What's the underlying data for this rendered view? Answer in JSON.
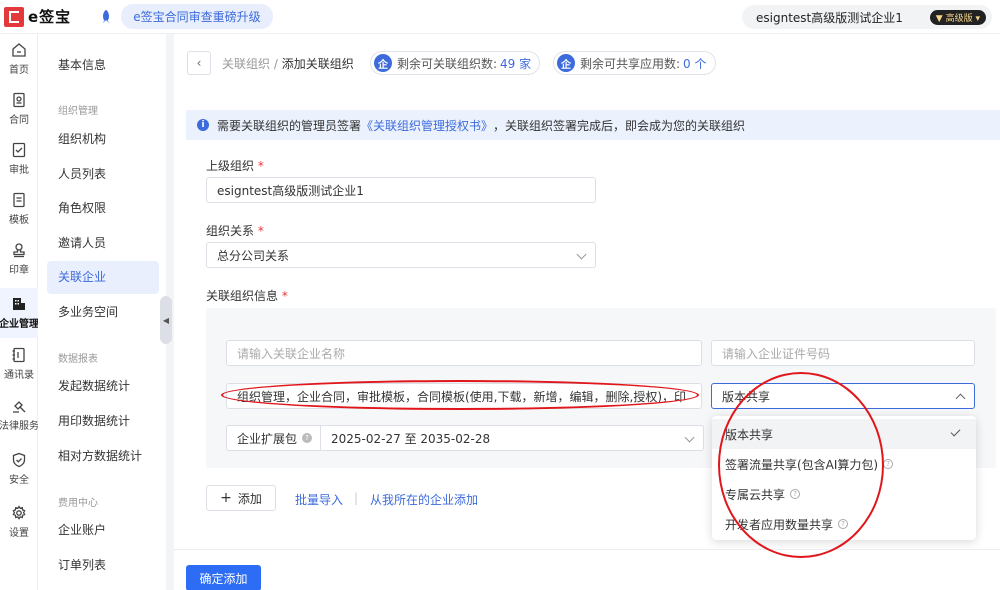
{
  "topbar": {
    "logo_text": "e签宝",
    "promo": "e签宝合同审查重磅升级",
    "company": "esigntest高级版测试企业1",
    "plan_badge": "高级版"
  },
  "rail": [
    {
      "label": "首页",
      "icon": "home-icon"
    },
    {
      "label": "合同",
      "icon": "contract-icon"
    },
    {
      "label": "审批",
      "icon": "approval-icon"
    },
    {
      "label": "模板",
      "icon": "template-icon"
    },
    {
      "label": "印章",
      "icon": "seal-icon"
    },
    {
      "label": "企业管理",
      "icon": "enterprise-icon"
    },
    {
      "label": "通讯录",
      "icon": "contacts-icon"
    },
    {
      "label": "法律服务",
      "icon": "legal-icon"
    },
    {
      "label": "安全",
      "icon": "shield-icon"
    },
    {
      "label": "设置",
      "icon": "gear-icon"
    }
  ],
  "menu": {
    "basic": "基本信息",
    "group_org": "组织管理",
    "org_items": [
      "组织机构",
      "人员列表",
      "角色权限",
      "邀请人员",
      "关联企业",
      "多业务空间"
    ],
    "group_report": "数据报表",
    "report_items": [
      "发起数据统计",
      "用印数据统计",
      "相对方数据统计"
    ],
    "group_fee": "费用中心",
    "fee_items": [
      "企业账户",
      "订单列表"
    ]
  },
  "header": {
    "breadcrumb_parent": "关联组织",
    "breadcrumb_sep": " / ",
    "breadcrumb_current": "添加关联组织",
    "chip1_label": "剩余可关联组织数:",
    "chip1_value": "49 家",
    "chip2_label": "剩余可共享应用数:",
    "chip2_value": "0 个"
  },
  "notice": {
    "prefix": "需要关联组织的管理员签署",
    "link": "《关联组织管理授权书》",
    "suffix": "，关联组织签署完成后，即会成为您的关联组织"
  },
  "form": {
    "parent_label": "上级组织",
    "parent_value": "esigntest高级版测试企业1",
    "relation_label": "组织关系",
    "relation_value": "总分公司关系",
    "info_label": "关联组织信息",
    "required_mark": "*",
    "name_placeholder": "请输入关联企业名称",
    "id_placeholder": "请输入企业证件号码",
    "permissions_value": "组织管理，企业合同，审批模板，合同模板(使用,下载，新增，编辑，删除,授权)，印",
    "share_value": "版本共享",
    "ext_label": "企业扩展包",
    "ext_value": "2025-02-27 至 2035-02-28"
  },
  "dropdown": {
    "options": [
      "版本共享",
      "签署流量共享(包含AI算力包)",
      "专属云共享",
      "开发者应用数量共享"
    ]
  },
  "actions": {
    "add_label": "添加",
    "batch_import": "批量导入",
    "separator": "|",
    "add_from_mine": "从我所在的企业添加",
    "confirm": "确定添加"
  },
  "colors": {
    "primary": "#2d6df6",
    "annotation": "#e0161b",
    "logo": "#e4393c"
  }
}
